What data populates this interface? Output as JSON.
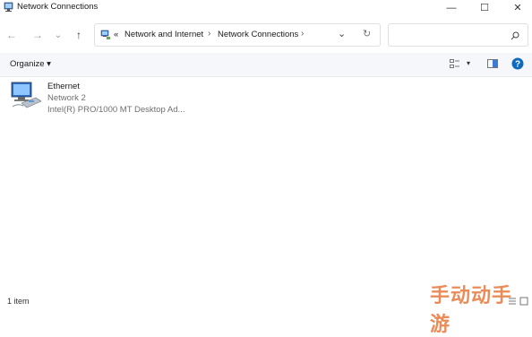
{
  "window": {
    "title": "Network Connections"
  },
  "window_controls": {
    "minimize": "—",
    "maximize": "☐",
    "close": "✕"
  },
  "nav": {
    "back": "←",
    "forward": "→",
    "recent": "⌄",
    "up": "↑"
  },
  "address_bar": {
    "overflow": "«",
    "crumbs": [
      "Network and Internet",
      "Network Connections"
    ],
    "separator": "›",
    "dropdown": "⌄",
    "refresh": "↻"
  },
  "search": {
    "placeholder": "",
    "icon": "search-icon"
  },
  "command_bar": {
    "organize_label": "Organize ▾",
    "view_dropdown": "▾"
  },
  "items": [
    {
      "name": "Ethernet",
      "network": "Network 2",
      "adapter": "Intel(R) PRO/1000 MT Desktop Ad..."
    }
  ],
  "status": {
    "item_count": "1 item"
  },
  "watermark": {
    "text": "手动动手游"
  },
  "colors": {
    "accent": "#0f6cbd",
    "command_bar_bg": "#f5f7fa"
  }
}
